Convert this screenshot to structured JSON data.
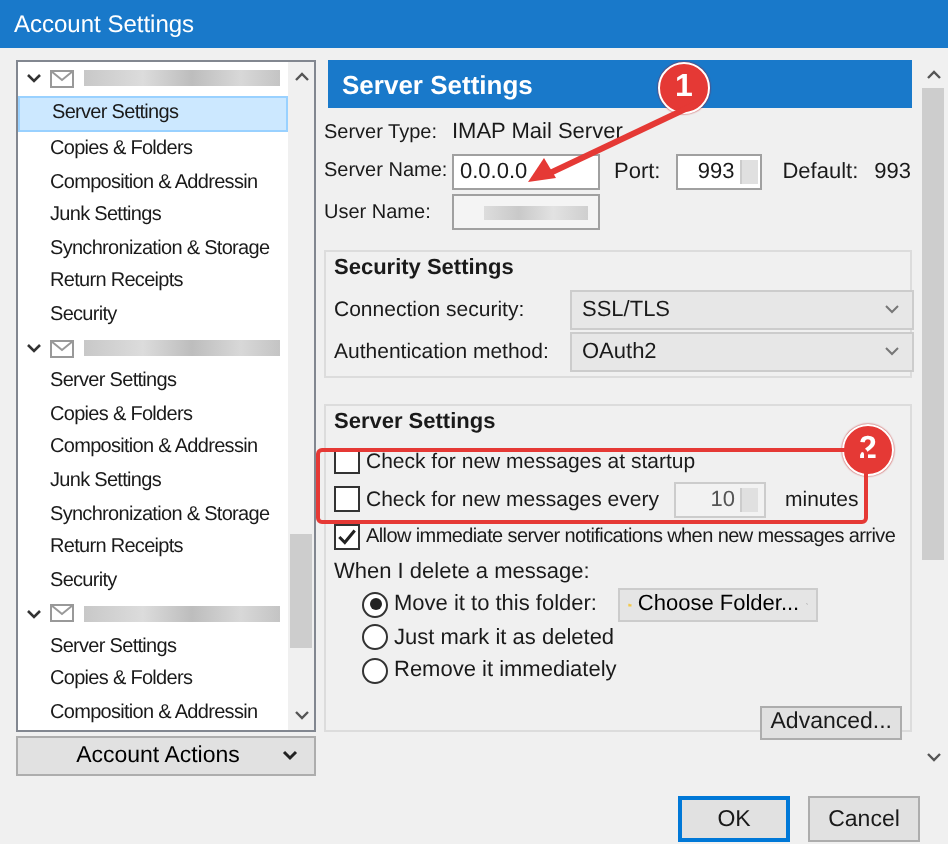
{
  "window": {
    "title": "Account Settings"
  },
  "tree": {
    "accounts": [
      {
        "expanded": true,
        "children": [
          {
            "label": "Server Settings",
            "selected": true
          },
          {
            "label": "Copies & Folders",
            "selected": false
          },
          {
            "label": "Composition & Addressin",
            "selected": false
          },
          {
            "label": "Junk Settings",
            "selected": false
          },
          {
            "label": "Synchronization & Storage",
            "selected": false
          },
          {
            "label": "Return Receipts",
            "selected": false
          },
          {
            "label": "Security",
            "selected": false
          }
        ]
      },
      {
        "expanded": true,
        "children": [
          {
            "label": "Server Settings",
            "selected": false
          },
          {
            "label": "Copies & Folders",
            "selected": false
          },
          {
            "label": "Composition & Addressin",
            "selected": false
          },
          {
            "label": "Junk Settings",
            "selected": false
          },
          {
            "label": "Synchronization & Storage",
            "selected": false
          },
          {
            "label": "Return Receipts",
            "selected": false
          },
          {
            "label": "Security",
            "selected": false
          }
        ]
      },
      {
        "expanded": true,
        "children": [
          {
            "label": "Server Settings",
            "selected": false
          },
          {
            "label": "Copies & Folders",
            "selected": false
          },
          {
            "label": "Composition & Addressin",
            "selected": false
          }
        ]
      }
    ]
  },
  "account_actions": "Account Actions",
  "panel": {
    "header": "Server Settings",
    "server_type": {
      "label": "Server Type:",
      "value": "IMAP Mail Server"
    },
    "server_name": {
      "label": "Server Name:",
      "value": "0.0.0.0"
    },
    "port": {
      "label": "Port:",
      "value": "993"
    },
    "default": {
      "label": "Default:",
      "value": "993"
    },
    "user_name": {
      "label": "User Name:"
    },
    "security": {
      "title": "Security Settings",
      "connection_security": {
        "label": "Connection security:",
        "value": "SSL/TLS"
      },
      "authentication": {
        "label": "Authentication method:",
        "value": "OAuth2"
      }
    },
    "server_settings": {
      "title": "Server Settings",
      "check_startup": {
        "label": "Check for new messages at startup",
        "checked": false
      },
      "check_every": {
        "label": "Check for new messages every",
        "checked": false,
        "value": "10",
        "unit": "minutes"
      },
      "allow_notifications": {
        "label": "Allow immediate server notifications when new messages arrive",
        "checked": true
      },
      "delete_label": "When I delete a message:",
      "delete_options": [
        {
          "label": "Move it to this folder:",
          "selected": true
        },
        {
          "label": "Just mark it as deleted",
          "selected": false
        },
        {
          "label": "Remove it immediately",
          "selected": false
        }
      ],
      "folder_button": "Choose Folder...",
      "advanced_button": "Advanced..."
    }
  },
  "buttons": [
    {
      "label": "OK",
      "default": true
    },
    {
      "label": "Cancel",
      "default": false
    }
  ],
  "annotations": [
    {
      "label": "1"
    },
    {
      "label": "2"
    }
  ]
}
